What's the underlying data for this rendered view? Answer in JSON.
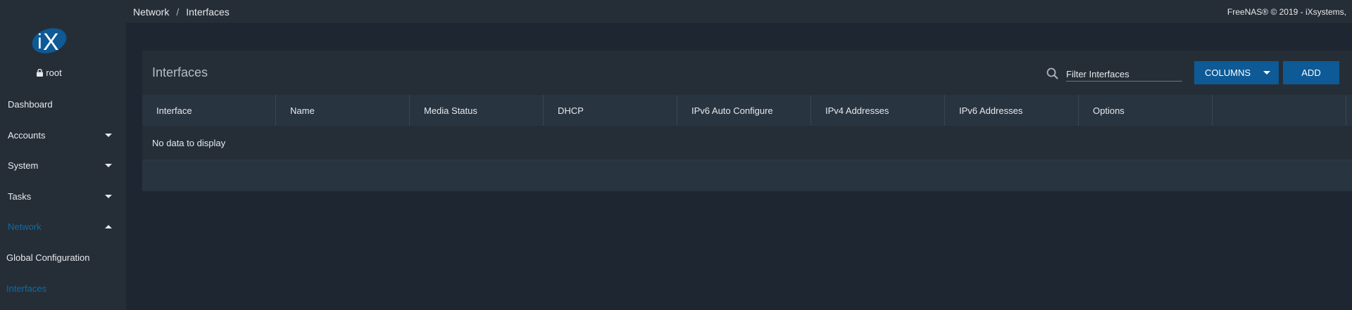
{
  "sidebar": {
    "user": "root",
    "items": [
      {
        "label": "Dashboard",
        "caret": ""
      },
      {
        "label": "Accounts",
        "caret": "down"
      },
      {
        "label": "System",
        "caret": "down"
      },
      {
        "label": "Tasks",
        "caret": "down"
      },
      {
        "label": "Network",
        "caret": "up",
        "active": true
      },
      {
        "label": "Global Configuration",
        "caret": ""
      },
      {
        "label": "Interfaces",
        "caret": "",
        "active": true
      }
    ]
  },
  "topbar": {
    "breadcrumb": [
      "Network",
      "Interfaces"
    ],
    "separator": "/",
    "copyright": "FreeNAS® © 2019 - iXsystems,"
  },
  "card": {
    "title": "Interfaces",
    "filter_placeholder": "Filter Interfaces",
    "columns_label": "COLUMNS",
    "add_label": "ADD",
    "columns": [
      "Interface",
      "Name",
      "Media Status",
      "DHCP",
      "IPv6 Auto Configure",
      "IPv4 Addresses",
      "IPv6 Addresses",
      "Options",
      ""
    ],
    "empty_message": "No data to display"
  },
  "colors": {
    "accent": "#0d5a96",
    "active_link": "#0d6ba8",
    "background": "#1e2731",
    "panel": "#252e37"
  }
}
